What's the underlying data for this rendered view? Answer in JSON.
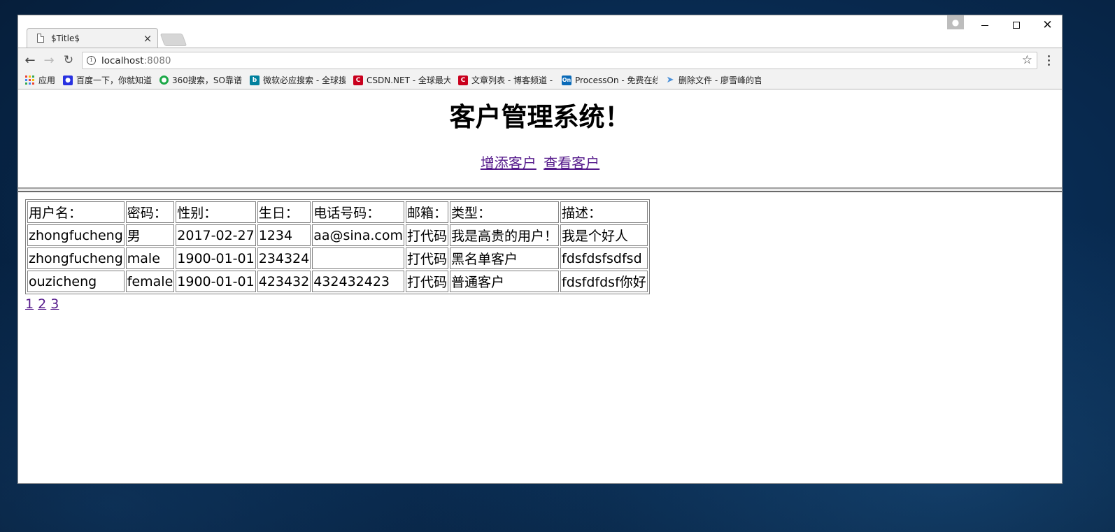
{
  "browser": {
    "tab_title": "$Title$",
    "tab_close_glyph": "×",
    "url_host": "localhost",
    "url_port": ":8080",
    "bookmarks": [
      {
        "label": "应用",
        "icon": "apps-grid-icon",
        "color": "#e94235"
      },
      {
        "label": "百度一下，你就知道",
        "icon": "baidu-paw-icon",
        "color": "#2932e1"
      },
      {
        "label": "360搜索，SO靠谱",
        "icon": "so360-icon",
        "color": "#1ba847"
      },
      {
        "label": "微软必应搜索 - 全球搜",
        "icon": "bing-icon",
        "color": "#00809d"
      },
      {
        "label": "CSDN.NET - 全球最大",
        "icon": "csdn-icon",
        "color": "#c9001d"
      },
      {
        "label": "文章列表 - 博客频道 -",
        "icon": "csdn-blog-icon",
        "color": "#c9001d"
      },
      {
        "label": "ProcessOn - 免费在线",
        "icon": "processon-icon",
        "color": "#0a6ab8"
      },
      {
        "label": "删除文件 - 廖雪峰的官",
        "icon": "rocket-icon",
        "color": "#4a90d9"
      }
    ]
  },
  "page": {
    "title": "客户管理系统！",
    "nav": {
      "add_customer": "增添客户",
      "view_customer": "查看客户"
    },
    "table": {
      "headers": [
        "用户名：",
        "密码：",
        "性别：",
        "生日：",
        "电话号码：",
        "邮箱：",
        "类型：",
        "描述："
      ],
      "rows": [
        [
          "zhongfucheng",
          "男",
          "2017-02-27",
          "1234",
          "aa@sina.com",
          "打代码",
          "我是高贵的用户！",
          "我是个好人"
        ],
        [
          "zhongfucheng",
          "male",
          "1900-01-01",
          "234324",
          "",
          "打代码",
          "黑名单客户",
          "fdsfdsfsdfsd"
        ],
        [
          "ouzicheng",
          "female",
          "1900-01-01",
          "423432",
          "432432423",
          "打代码",
          "普通客户",
          "fdsfdfdsf你好"
        ]
      ]
    },
    "pager": [
      "1",
      "2",
      "3"
    ]
  }
}
